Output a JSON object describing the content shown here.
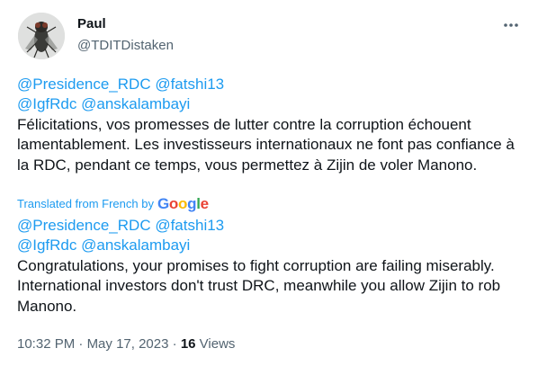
{
  "author": {
    "display_name": "Paul",
    "handle": "@TDITDistaken",
    "avatar_icon": "fly-avatar-icon"
  },
  "more_icon": "more-options-icon",
  "original": {
    "mentions_line1": [
      "@Presidence_RDC",
      "@fatshi13"
    ],
    "mentions_line2": [
      "@IgfRdc",
      "@anskalambayi"
    ],
    "text": "Félicitations, vos promesses de lutter contre la corruption échouent lamentablement. Les investisseurs internationaux ne font pas confiance à la RDC, pendant ce temps, vous permettez à Zijin de voler Manono."
  },
  "translation": {
    "label": "Translated from French by",
    "provider": "Google",
    "mentions_line1": [
      "@Presidence_RDC",
      "@fatshi13"
    ],
    "mentions_line2": [
      "@IgfRdc",
      "@anskalambayi"
    ],
    "text": "Congratulations, your promises to fight corruption are failing miserably. International investors don't trust DRC, meanwhile you allow Zijin to rob Manono."
  },
  "meta": {
    "time": "10:32 PM",
    "separator": "·",
    "date": "May 17, 2023",
    "views_count": "16",
    "views_label": "Views"
  },
  "colors": {
    "link": "#1d9bf0",
    "text": "#0f1419",
    "secondary": "#536471"
  }
}
